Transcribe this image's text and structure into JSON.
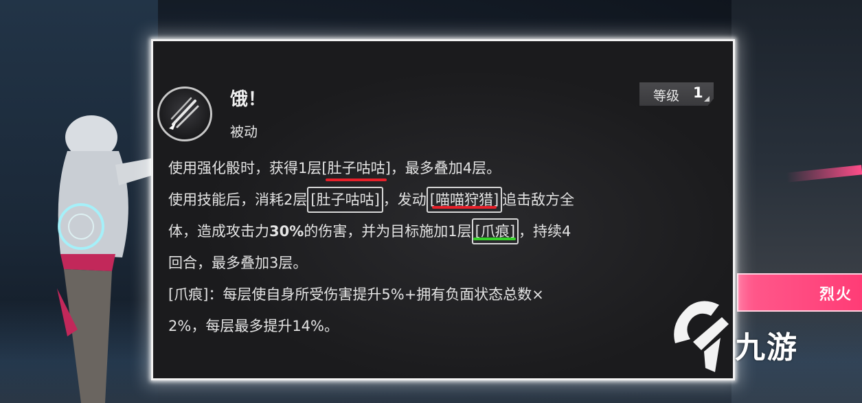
{
  "skill": {
    "name": "饿！",
    "type": "被动",
    "level_label": "等级",
    "level_value": "1",
    "icon": "claw-slash-icon"
  },
  "description": {
    "line1": {
      "a": "使用强化骰时，获得1层",
      "kw1": "[肚子咕咕]",
      "b": "，最多叠加4层。"
    },
    "line2": {
      "a": "使用技能后，消耗2层",
      "kw1": "[肚子咕咕]",
      "b": "，发动",
      "kw2": "[喵喵狩猎]",
      "c": "追击敌方全"
    },
    "line3": {
      "a": "体，造成攻击力",
      "pct": "30%",
      "b": "的伤害，并为目标施加1层",
      "kw1": "[爪痕]",
      "c": "，持续4"
    },
    "line4": "回合，最多叠加3层。",
    "line5": "[爪痕]：每层使自身所受伤害提升5%+拥有负面状态总数×",
    "line6": "2%，每层最多提升14%。"
  },
  "side_banner": "烈火",
  "watermark": "九游",
  "colors": {
    "underline_red": "#e8202a",
    "underline_green": "#35d12a",
    "banner_pink": "#ff3c76"
  }
}
